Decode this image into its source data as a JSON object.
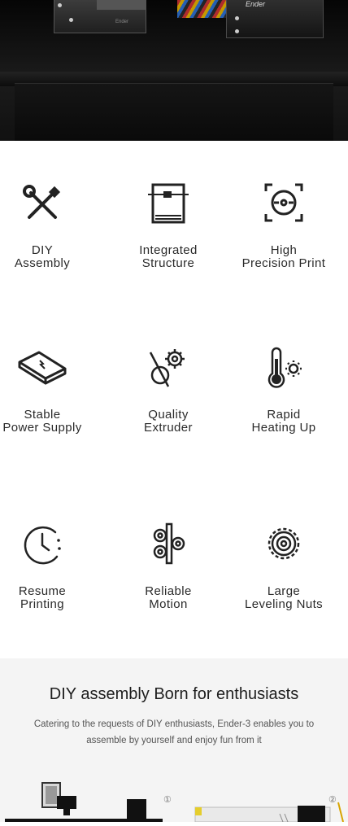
{
  "hero": {
    "brand_text": "Ender",
    "brand_small": "Ender"
  },
  "features": [
    {
      "icon": "tools-icon",
      "label": "DIY\nAssembly"
    },
    {
      "icon": "frame-structure-icon",
      "label": "Integrated\nStructure"
    },
    {
      "icon": "precision-target-icon",
      "label": "High\nPrecision Print"
    },
    {
      "icon": "power-supply-icon",
      "label": "Stable\nPower Supply"
    },
    {
      "icon": "extruder-gear-icon",
      "label": "Quality\nExtruder"
    },
    {
      "icon": "thermometer-sun-icon",
      "label": "Rapid\nHeating Up"
    },
    {
      "icon": "clock-resume-icon",
      "label": "Resume\nPrinting"
    },
    {
      "icon": "rail-wheels-icon",
      "label": "Reliable\nMotion"
    },
    {
      "icon": "leveling-nut-icon",
      "label": "Large\nLeveling Nuts"
    }
  ],
  "section": {
    "title": "DIY assembly Born for enthusiasts",
    "description": "Catering to the requests of DIY enthusiasts, Ender-3 enables you to assemble by yourself and enjoy fun from it"
  },
  "products": [
    {
      "number": "①"
    },
    {
      "number": "②"
    }
  ]
}
